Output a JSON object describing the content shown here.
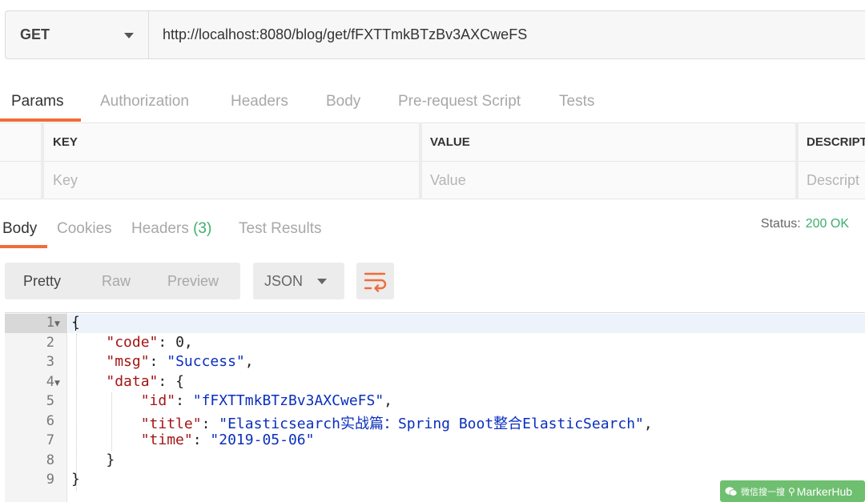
{
  "request": {
    "method": "GET",
    "url": "http://localhost:8080/blog/get/fFXTTmkBTzBv3AXCweFS"
  },
  "request_tabs": [
    "Params",
    "Authorization",
    "Headers",
    "Body",
    "Pre-request Script",
    "Tests"
  ],
  "params": {
    "columns": [
      "KEY",
      "VALUE",
      "DESCRIPTI"
    ],
    "placeholders": [
      "Key",
      "Value",
      "Descript"
    ]
  },
  "response_tabs": {
    "body": "Body",
    "cookies": "Cookies",
    "headers": "Headers",
    "headers_count": "(3)",
    "test_results": "Test Results"
  },
  "status": {
    "label": "Status:",
    "value": "200 OK"
  },
  "view_modes": [
    "Pretty",
    "Raw",
    "Preview"
  ],
  "format": "JSON",
  "code_lines": [
    "1",
    "2",
    "3",
    "4",
    "5",
    "6",
    "7",
    "8",
    "9"
  ],
  "json": {
    "open": "{",
    "close": "}",
    "code_key": "\"code\"",
    "code_val": "0",
    "msg_key": "\"msg\"",
    "msg_val": "\"Success\"",
    "data_key": "\"data\"",
    "id_key": "\"id\"",
    "id_val": "\"fFXTTmkBTzBv3AXCweFS\"",
    "title_key": "\"title\"",
    "title_val": "\"Elasticsearch实战篇：Spring Boot整合ElasticSearch\"",
    "time_key": "\"time\"",
    "time_val": "\"2019-05-06\""
  },
  "watermark": {
    "prefix": "微信搜一搜",
    "brand": "MarkerHub"
  },
  "colors": {
    "accent": "#f26b3a",
    "success": "#3fae6e"
  }
}
